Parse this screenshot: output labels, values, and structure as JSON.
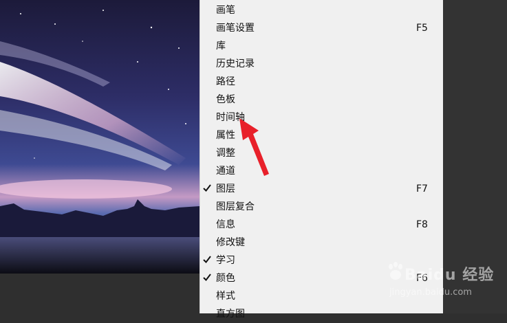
{
  "menu": {
    "items": [
      {
        "label": "画笔",
        "shortcut": "",
        "checked": false
      },
      {
        "label": "画笔设置",
        "shortcut": "F5",
        "checked": false
      },
      {
        "label": "库",
        "shortcut": "",
        "checked": false
      },
      {
        "label": "历史记录",
        "shortcut": "",
        "checked": false
      },
      {
        "label": "路径",
        "shortcut": "",
        "checked": false
      },
      {
        "label": "色板",
        "shortcut": "",
        "checked": false
      },
      {
        "label": "时间轴",
        "shortcut": "",
        "checked": false
      },
      {
        "label": "属性",
        "shortcut": "",
        "checked": false
      },
      {
        "label": "调整",
        "shortcut": "",
        "checked": false
      },
      {
        "label": "通道",
        "shortcut": "",
        "checked": false
      },
      {
        "label": "图层",
        "shortcut": "F7",
        "checked": true
      },
      {
        "label": "图层复合",
        "shortcut": "",
        "checked": false
      },
      {
        "label": "信息",
        "shortcut": "F8",
        "checked": false
      },
      {
        "label": "修改键",
        "shortcut": "",
        "checked": false
      },
      {
        "label": "学习",
        "shortcut": "",
        "checked": true
      },
      {
        "label": "颜色",
        "shortcut": "F6",
        "checked": true
      },
      {
        "label": "样式",
        "shortcut": "",
        "checked": false
      },
      {
        "label": "直方图",
        "shortcut": "",
        "checked": false
      }
    ]
  },
  "annotation": {
    "color": "#e8202a"
  },
  "watermark": {
    "brand": "Baidu 经验",
    "url": "jingyan.baidu.com"
  },
  "icons": {
    "check": "check-icon",
    "arrow": "red-arrow-icon"
  }
}
